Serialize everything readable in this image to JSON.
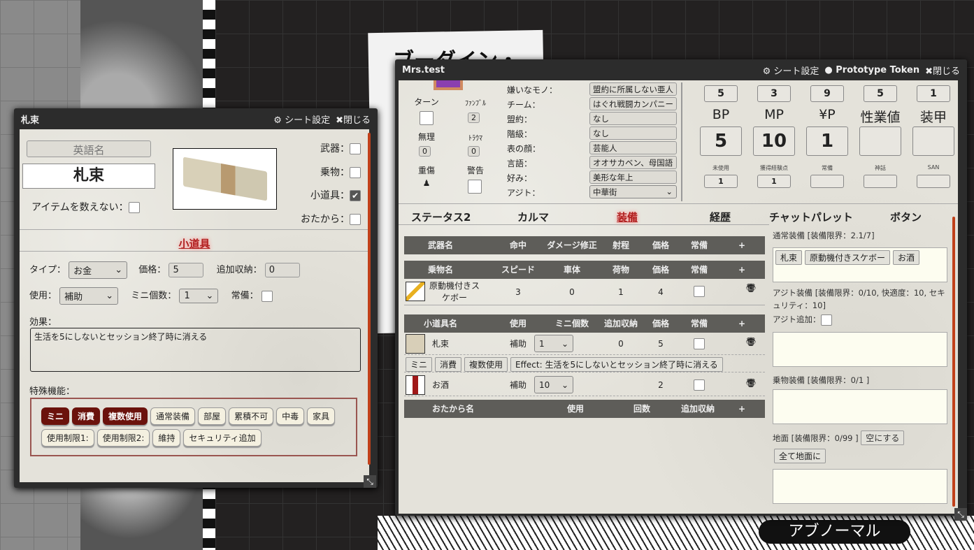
{
  "background": {
    "title": "ブーダイン・",
    "tag": "アブノーマル"
  },
  "item_window": {
    "title": "札束",
    "settings_label": "シート設定",
    "close_label": "閉じる",
    "english_name_placeholder": "英語名",
    "name": "札束",
    "uncountable_label": "アイテムを数えない：",
    "category_checks": [
      {
        "label": "武器：",
        "checked": false
      },
      {
        "label": "乗物：",
        "checked": false
      },
      {
        "label": "小道具：",
        "checked": true
      },
      {
        "label": "おたから：",
        "checked": false
      }
    ],
    "section_heading": "小道具",
    "type_label": "タイプ：",
    "type_value": "お金",
    "price_label": "価格：",
    "price_value": "5",
    "storage_label": "追加収納：",
    "storage_value": "0",
    "use_label": "使用：",
    "use_value": "補助",
    "mini_count_label": "ミニ個数：",
    "mini_count_value": "1",
    "always_label": "常備：",
    "effect_label": "効果：",
    "effect_value": "生活を5にしないとセッション終了時に消える",
    "special_label": "特殊機能：",
    "special_chips": [
      {
        "label": "ミニ",
        "on": true
      },
      {
        "label": "消費",
        "on": true
      },
      {
        "label": "複数使用",
        "on": true
      },
      {
        "label": "通常装備",
        "on": false
      },
      {
        "label": "部屋",
        "on": false
      },
      {
        "label": "累積不可",
        "on": false
      },
      {
        "label": "中毒",
        "on": false
      },
      {
        "label": "家具",
        "on": false
      },
      {
        "label": "使用制限1:",
        "on": false
      },
      {
        "label": "使用制限2:",
        "on": false
      },
      {
        "label": "維持",
        "on": false
      },
      {
        "label": "セキュリティ追加",
        "on": false
      }
    ]
  },
  "char_window": {
    "title": "Mrs.test",
    "settings_label": "シート設定",
    "token_label": "Prototype Token",
    "close_label": "閉じる",
    "counters": {
      "turn": "ターン",
      "fumble": "ﾌｧﾝﾌﾞﾙ",
      "fumble_value": "2",
      "muri": "無理",
      "muri_value": "0",
      "trauma": "ﾄﾗｳﾏ",
      "trauma_value": "0",
      "heavy": "重傷",
      "warning": "警告"
    },
    "profile": [
      {
        "label": "嫌いなモノ：",
        "value": "盟約に所属しない亜人"
      },
      {
        "label": "チーム：",
        "value": "はぐれ戦闘カンパニー"
      },
      {
        "label": "盟約：",
        "value": "なし"
      },
      {
        "label": "階級：",
        "value": "なし"
      },
      {
        "label": "表の顔：",
        "value": "芸能人"
      },
      {
        "label": "言語：",
        "value": "オオサカベン、母国語"
      },
      {
        "label": "好み：",
        "value": "美形な年上"
      },
      {
        "label": "アジト：",
        "value": "中華街"
      }
    ],
    "stats": [
      {
        "top": "5",
        "label": "BP",
        "value": "5"
      },
      {
        "top": "3",
        "label": "MP",
        "value": "10"
      },
      {
        "top": "9",
        "label": "¥P",
        "value": "1"
      },
      {
        "top": "5",
        "label": "性業値",
        "value": ""
      },
      {
        "top": "1",
        "label": "装甲",
        "value": ""
      }
    ],
    "sub_stats": [
      {
        "label": "未使用",
        "value": "1"
      },
      {
        "label": "獲得経験点",
        "value": "1"
      },
      {
        "label": "常備",
        "value": ""
      },
      {
        "label": "神話",
        "value": ""
      },
      {
        "label": "SAN",
        "value": ""
      }
    ],
    "tabs": [
      "ステータス2",
      "カルマ",
      "装備",
      "経歴",
      "チャットパレット",
      "ボタン"
    ],
    "active_tab": "装備",
    "weapons_header": [
      "武器名",
      "命中",
      "ダメージ修正",
      "射程",
      "価格",
      "常備",
      "+"
    ],
    "vehicles_header": [
      "乗物名",
      "スピード",
      "車体",
      "荷物",
      "価格",
      "常備",
      "+"
    ],
    "vehicles": [
      {
        "name": "原動機付きスケボー",
        "speed": "3",
        "body": "0",
        "cargo": "1",
        "price": "4"
      }
    ],
    "gear_header": [
      "小道具名",
      "使用",
      "ミニ個数",
      "追加収納",
      "価格",
      "常備",
      "+"
    ],
    "gear": [
      {
        "name": "札束",
        "use": "補助",
        "mini": "1",
        "storage": "0",
        "price": "5",
        "tags": [
          "ミニ",
          "消費",
          "複数使用",
          "Effect: 生活を5にしないとセッション終了時に消える"
        ]
      },
      {
        "name": "お酒",
        "use": "補助",
        "mini": "10",
        "storage": "",
        "price": "2"
      }
    ],
    "treasure_header": [
      "おたから名",
      "使用",
      "回数",
      "追加収納",
      "+"
    ],
    "normal_equip_label": "通常装備 [装備限界：2.1/7]",
    "normal_equip_items": [
      "札束",
      "原動機付きスケボー",
      "お酒"
    ],
    "hideout_equip_label": "アジト装備 [装備限界：0/10, 快適度：10, セキュリティ：10]",
    "hideout_add_label": "アジト追加：",
    "vehicle_equip_label": "乗物装備 [装備限界：0/1 ]",
    "ground_label": "地面 [装備限界：0/99 ]",
    "empty_button": "空にする",
    "all_to_ground_button": "全て地面に"
  }
}
